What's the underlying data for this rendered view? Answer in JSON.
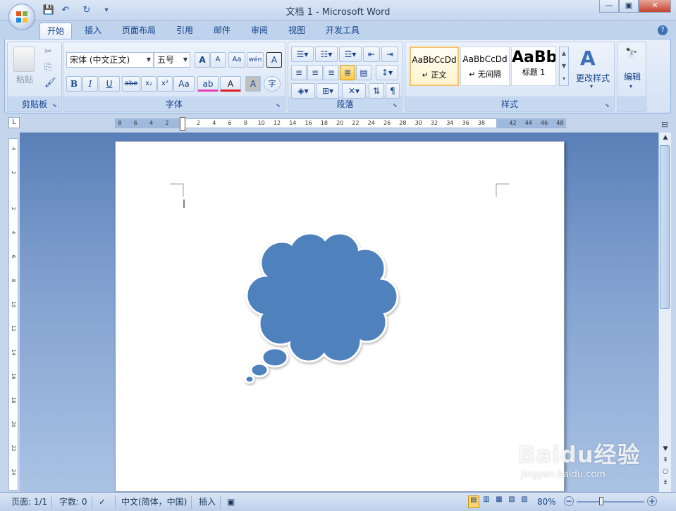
{
  "window": {
    "title": "文档 1 - Microsoft Word",
    "minimize": "—",
    "restore": "▣",
    "close": "✕"
  },
  "qat": {
    "save": "💾",
    "undo": "↶",
    "redo": "↻",
    "customize": "▾"
  },
  "tabs": [
    {
      "label": "开始",
      "active": true
    },
    {
      "label": "插入"
    },
    {
      "label": "页面布局"
    },
    {
      "label": "引用"
    },
    {
      "label": "邮件"
    },
    {
      "label": "审阅"
    },
    {
      "label": "视图"
    },
    {
      "label": "开发工具"
    }
  ],
  "help": "?",
  "clipboard": {
    "label": "剪贴板",
    "paste": "粘贴",
    "cut": "✂",
    "copy": "⎘",
    "format_painter": "🖌"
  },
  "font": {
    "label": "字体",
    "family": "宋体 (中文正文)",
    "size": "五号",
    "grow": "A",
    "shrink": "A",
    "clear": "Aa",
    "phonetic": "wén",
    "border": "A",
    "bold": "B",
    "italic": "I",
    "underline": "U",
    "strike": "abe",
    "subscript": "x₂",
    "superscript": "x²",
    "case": "Aa",
    "highlight": "ab",
    "color": "A",
    "shade": "A",
    "enclose": "字"
  },
  "paragraph": {
    "label": "段落"
  },
  "styles": {
    "label": "样式",
    "items": [
      {
        "preview": "AaBbCcDd",
        "name": "↵ 正文"
      },
      {
        "preview": "AaBbCcDd",
        "name": "↵ 无间隔"
      },
      {
        "preview": "AaBb",
        "name": "标题 1"
      }
    ],
    "change": "更改样式"
  },
  "editing": {
    "label": "编辑"
  },
  "ruler": {
    "corner": "L",
    "ticks": [
      "8",
      "6",
      "4",
      "2",
      "",
      "2",
      "4",
      "6",
      "8",
      "10",
      "12",
      "14",
      "16",
      "18",
      "20",
      "22",
      "24",
      "26",
      "28",
      "30",
      "32",
      "34",
      "36",
      "38",
      "",
      "42",
      "44",
      "46",
      "48"
    ],
    "vticks": [
      "4",
      "",
      "2",
      "",
      "",
      "2",
      "",
      "4",
      "",
      "6",
      "",
      "8",
      "",
      "10",
      "",
      "12",
      "",
      "14",
      "",
      "16",
      "",
      "18",
      "",
      "20",
      "",
      "22",
      "",
      "24"
    ]
  },
  "status": {
    "page": "页面: 1/1",
    "words": "字数: 0",
    "language": "中文(简体，中国)",
    "mode": "插入",
    "zoom": "80%"
  },
  "watermark": {
    "brand": "Baidu经验",
    "url": "jingyan.baidu.com"
  },
  "colors": {
    "shape_fill": "#4f81bd",
    "ribbon_border": "#8db2e3",
    "accent": "#15428b"
  }
}
